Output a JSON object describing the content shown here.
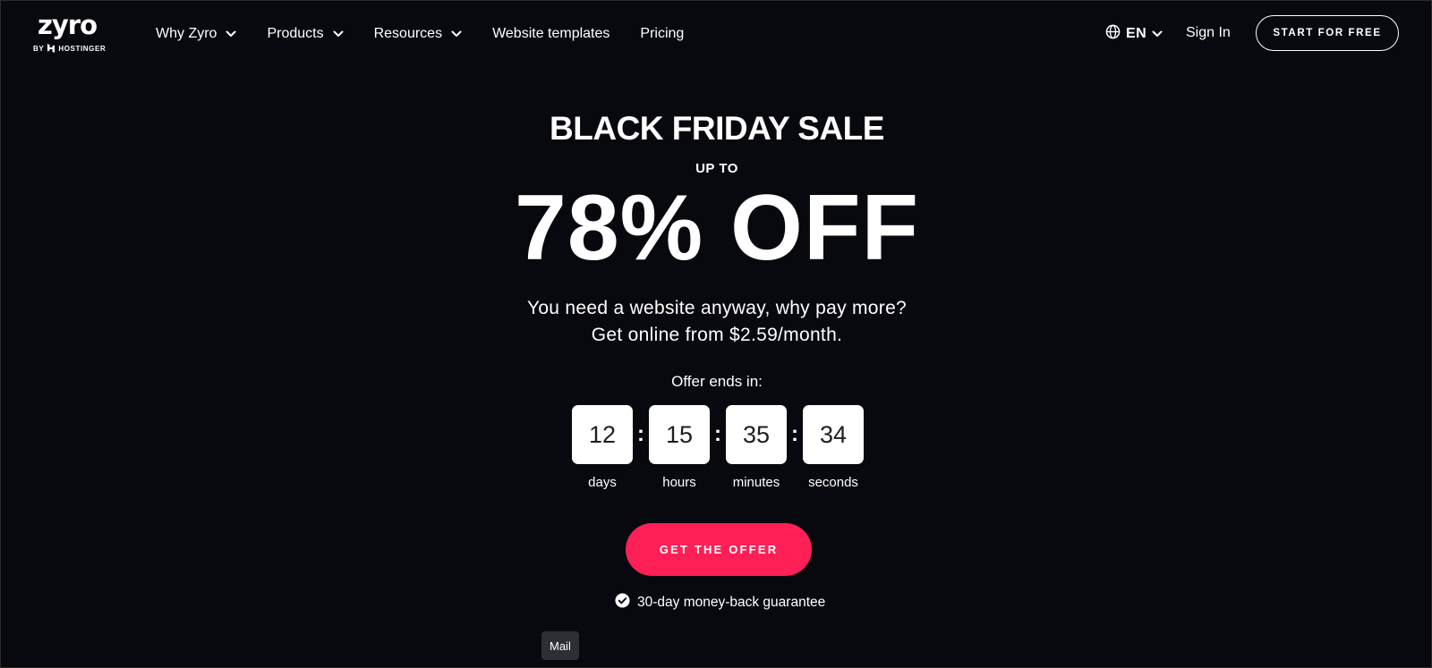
{
  "brand": {
    "name": "zyro",
    "by": "BY",
    "parent": "HOSTINGER"
  },
  "nav": {
    "items": [
      {
        "label": "Why Zyro",
        "dropdown": true
      },
      {
        "label": "Products",
        "dropdown": true
      },
      {
        "label": "Resources",
        "dropdown": true
      },
      {
        "label": "Website templates",
        "dropdown": false
      },
      {
        "label": "Pricing",
        "dropdown": false
      }
    ],
    "language": "EN",
    "sign_in": "Sign In",
    "start_button": "START FOR FREE"
  },
  "hero": {
    "title": "BLACK FRIDAY SALE",
    "pre_discount": "UP TO",
    "discount": "78% OFF",
    "subline_1": "You need a website anyway, why pay more?",
    "subline_2": "Get online from $2.59/month.",
    "offer_ends_label": "Offer ends in:"
  },
  "countdown": {
    "days": {
      "value": "12",
      "label": "days"
    },
    "hours": {
      "value": "15",
      "label": "hours"
    },
    "minutes": {
      "value": "35",
      "label": "minutes"
    },
    "seconds": {
      "value": "34",
      "label": "seconds"
    },
    "separator": ":"
  },
  "cta": {
    "label": "GET THE OFFER"
  },
  "guarantee": {
    "text": "30-day money-back guarantee"
  },
  "tooltip": {
    "text": "Mail"
  },
  "colors": {
    "background": "#08090f",
    "accent": "#ff1f57",
    "text": "#ffffff",
    "tooltip_bg": "#2e2f35"
  },
  "icons": {
    "language": "globe-icon",
    "dropdown": "chevron-down-icon",
    "guarantee": "check-circle-icon",
    "brand_mark": "hostinger-logo-icon"
  }
}
